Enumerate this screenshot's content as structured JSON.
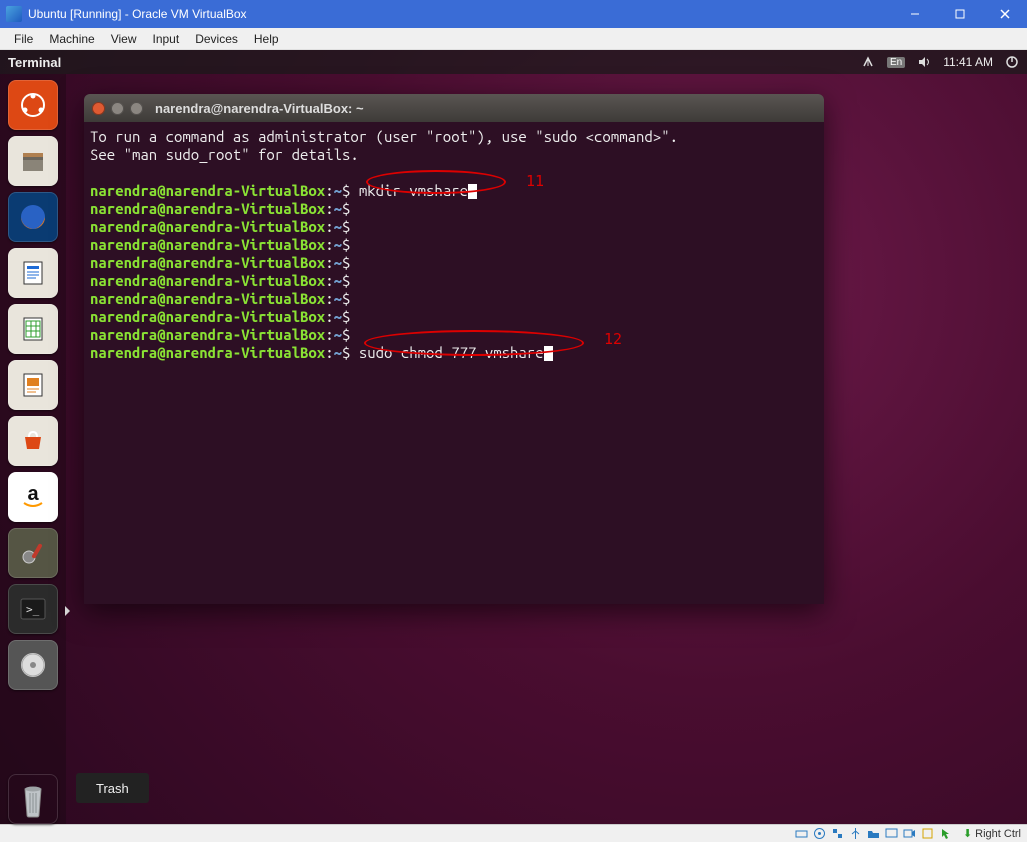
{
  "vb": {
    "title": "Ubuntu [Running] - Oracle VM VirtualBox",
    "menu": [
      "File",
      "Machine",
      "View",
      "Input",
      "Devices",
      "Help"
    ],
    "hostkey": "Right Ctrl"
  },
  "unity_panel": {
    "app": "Terminal",
    "lang": "En",
    "time": "11:41 AM"
  },
  "launcher": {
    "tooltip": "Trash"
  },
  "terminal": {
    "title": "narendra@narendra-VirtualBox: ~",
    "intro1": "To run a command as administrator (user \"root\"), use \"sudo <command>\".",
    "intro2": "See \"man sudo_root\" for details.",
    "prompt_user": "narendra@narendra-VirtualBox",
    "prompt_path": "~",
    "prompt_sep1": ":",
    "prompt_sep2": "$",
    "cmd1": "mkdir vmshare",
    "cmd2": "sudo chmod 777 vmshare"
  },
  "annotations": {
    "label1": "11",
    "label2": "12"
  }
}
